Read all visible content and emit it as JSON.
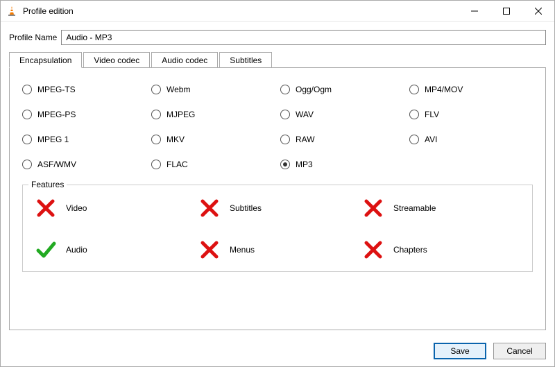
{
  "window": {
    "title": "Profile edition"
  },
  "profile": {
    "label": "Profile Name",
    "value": "Audio - MP3"
  },
  "tabs": [
    {
      "label": "Encapsulation",
      "active": true
    },
    {
      "label": "Video codec",
      "active": false
    },
    {
      "label": "Audio codec",
      "active": false
    },
    {
      "label": "Subtitles",
      "active": false
    }
  ],
  "formats": [
    {
      "label": "MPEG-TS",
      "selected": false
    },
    {
      "label": "Webm",
      "selected": false
    },
    {
      "label": "Ogg/Ogm",
      "selected": false
    },
    {
      "label": "MP4/MOV",
      "selected": false
    },
    {
      "label": "MPEG-PS",
      "selected": false
    },
    {
      "label": "MJPEG",
      "selected": false
    },
    {
      "label": "WAV",
      "selected": false
    },
    {
      "label": "FLV",
      "selected": false
    },
    {
      "label": "MPEG 1",
      "selected": false
    },
    {
      "label": "MKV",
      "selected": false
    },
    {
      "label": "RAW",
      "selected": false
    },
    {
      "label": "AVI",
      "selected": false
    },
    {
      "label": "ASF/WMV",
      "selected": false
    },
    {
      "label": "FLAC",
      "selected": false
    },
    {
      "label": "MP3",
      "selected": true
    }
  ],
  "features": {
    "legend": "Features",
    "items": [
      {
        "label": "Video",
        "supported": false
      },
      {
        "label": "Subtitles",
        "supported": false
      },
      {
        "label": "Streamable",
        "supported": false
      },
      {
        "label": "Audio",
        "supported": true
      },
      {
        "label": "Menus",
        "supported": false
      },
      {
        "label": "Chapters",
        "supported": false
      }
    ]
  },
  "buttons": {
    "save": "Save",
    "cancel": "Cancel"
  }
}
